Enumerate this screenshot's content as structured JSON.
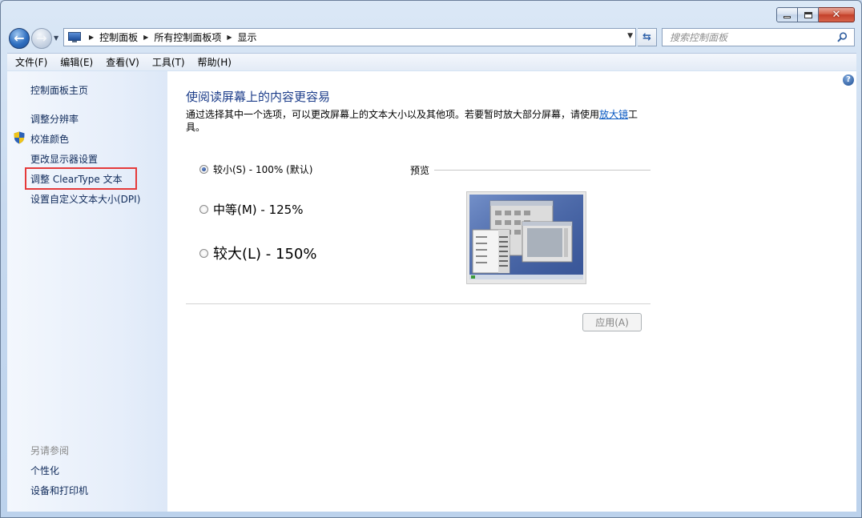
{
  "window": {
    "caption": {
      "minimize": "—",
      "maximize": "□",
      "close": "✕"
    }
  },
  "navigation": {
    "back_icon": "back-arrow-icon",
    "forward_icon": "forward-arrow-icon",
    "breadcrumbs": [
      "控制面板",
      "所有控制面板项",
      "显示"
    ],
    "search_placeholder": "搜索控制面板"
  },
  "menubar": {
    "items": [
      "文件(F)",
      "编辑(E)",
      "查看(V)",
      "工具(T)",
      "帮助(H)"
    ]
  },
  "sidebar": {
    "home": "控制面板主页",
    "links": [
      "调整分辨率",
      "校准颜色",
      "更改显示器设置",
      "调整 ClearType 文本",
      "设置自定义文本大小(DPI)"
    ],
    "see_also_title": "另请参阅",
    "see_also": [
      "个性化",
      "设备和打印机"
    ],
    "highlight_color": "#e53a3a"
  },
  "main": {
    "title": "使阅读屏幕上的内容更容易",
    "description_before": "通过选择其中一个选项，可以更改屏幕上的文本大小以及其他项。若要暂时放大部分屏幕，请使用",
    "description_link": "放大镜",
    "description_after": "工具。",
    "options": [
      {
        "label": "较小(S) - 100% (默认)",
        "selected": true
      },
      {
        "label": "中等(M) - 125%",
        "selected": false
      },
      {
        "label": "较大(L) - 150%",
        "selected": false
      }
    ],
    "preview_label": "预览",
    "apply_label": "应用(A)",
    "apply_enabled": false
  },
  "colors": {
    "heading": "#1c3d8a",
    "link": "#0a59c2",
    "sidebar_bg": "#e6eefa"
  }
}
